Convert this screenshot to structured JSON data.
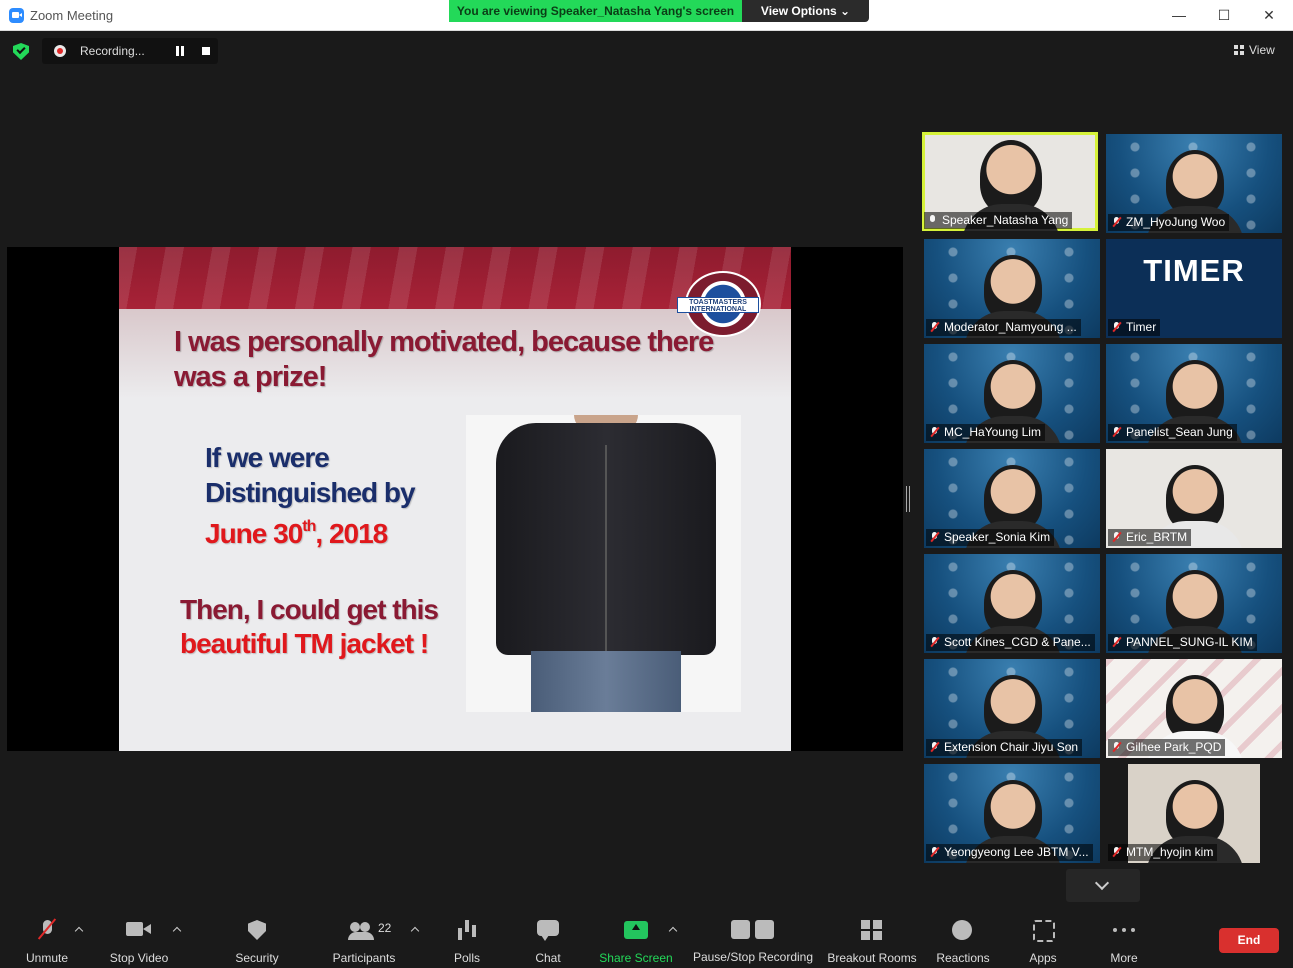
{
  "window": {
    "title": "Zoom Meeting",
    "min_icon": "minimize-icon",
    "max_icon": "maximize-icon",
    "close_icon": "close-icon"
  },
  "banner": {
    "viewing_text": "You are viewing Speaker_Natasha Yang's screen",
    "view_options_label": "View Options ⌄",
    "color": "#23d959"
  },
  "top_bar": {
    "recording_label": "Recording...",
    "view_label": "View"
  },
  "slide": {
    "headline_line1": "I was personally motivated, because there",
    "headline_line2": "was a prize!",
    "if_line1": "If we were",
    "if_line2": "Distinguished by",
    "date_main": "June 30",
    "date_sup": "th",
    "date_year": ", 2018",
    "then_line": "Then, I could get this",
    "then_red": "beautiful TM jacket !",
    "logo_text": "TOASTMASTERS INTERNATIONAL"
  },
  "participants": [
    {
      "name": "Speaker_Natasha Yang",
      "muted": false,
      "active": true
    },
    {
      "name": "ZM_HyoJung Woo",
      "muted": true,
      "active": false
    },
    {
      "name": "Moderator_Namyoung ...",
      "muted": true,
      "active": false
    },
    {
      "name": "Timer",
      "muted": true,
      "active": false,
      "display_text": "TIMER"
    },
    {
      "name": "MC_HaYoung Lim",
      "muted": true,
      "active": false
    },
    {
      "name": "Panelist_Sean Jung",
      "muted": true,
      "active": false
    },
    {
      "name": "Speaker_Sonia Kim",
      "muted": true,
      "active": false
    },
    {
      "name": "Eric_BRTM",
      "muted": true,
      "active": false
    },
    {
      "name": "Scott Kines_CGD & Pane...",
      "muted": true,
      "active": false
    },
    {
      "name": "PANNEL_SUNG-IL KIM",
      "muted": true,
      "active": false
    },
    {
      "name": "Extension Chair Jiyu Son",
      "muted": true,
      "active": false
    },
    {
      "name": "Gilhee Park_PQD",
      "muted": true,
      "active": false
    },
    {
      "name": "Yeongyeong Lee JBTM V...",
      "muted": true,
      "active": false
    },
    {
      "name": "MTM_hyojin kim",
      "muted": true,
      "active": false
    }
  ],
  "toolbar": {
    "unmute": "Unmute",
    "stop_video": "Stop Video",
    "security": "Security",
    "participants": "Participants",
    "participants_count": "22",
    "polls": "Polls",
    "chat": "Chat",
    "share_screen": "Share Screen",
    "pause_stop_recording": "Pause/Stop Recording",
    "breakout_rooms": "Breakout Rooms",
    "reactions": "Reactions",
    "apps": "Apps",
    "more": "More",
    "end": "End",
    "end_color": "#d9302e",
    "share_color": "#23c55e"
  }
}
